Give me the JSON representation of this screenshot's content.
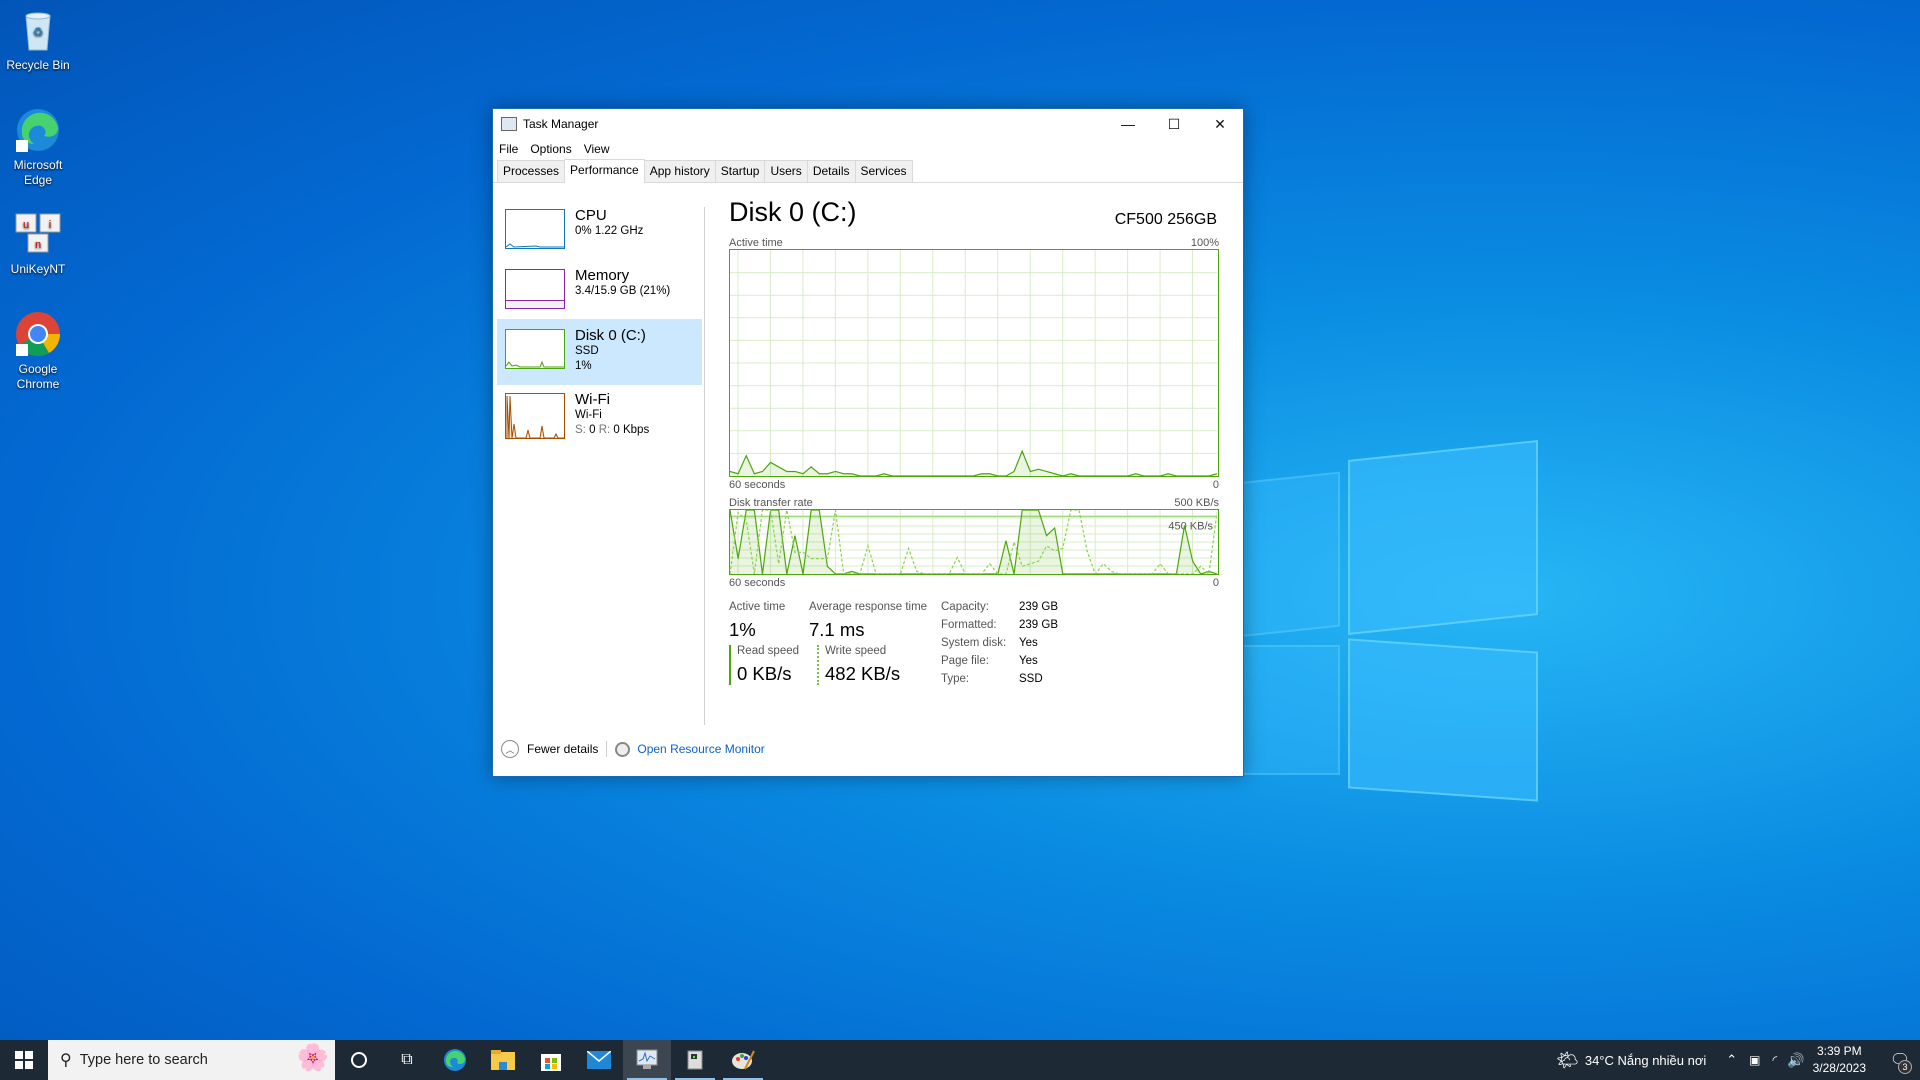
{
  "desktop": {
    "icons": [
      {
        "label": "Recycle Bin",
        "icon": "recycle-bin-icon"
      },
      {
        "label": "Microsoft Edge",
        "icon": "edge-icon"
      },
      {
        "label": "UniKeyNT",
        "icon": "unikey-icon"
      },
      {
        "label": "Google Chrome",
        "icon": "chrome-icon"
      }
    ]
  },
  "window": {
    "title": "Task Manager",
    "controls": {
      "minimize": "—",
      "maximize": "☐",
      "close": "✕"
    },
    "menu": [
      "File",
      "Options",
      "View"
    ],
    "tabs": [
      {
        "label": "Processes",
        "active": false
      },
      {
        "label": "Performance",
        "active": true
      },
      {
        "label": "App history",
        "active": false
      },
      {
        "label": "Startup",
        "active": false
      },
      {
        "label": "Users",
        "active": false
      },
      {
        "label": "Details",
        "active": false
      },
      {
        "label": "Services",
        "active": false
      }
    ]
  },
  "sidebar": {
    "items": [
      {
        "name": "CPU",
        "line1": "0% 1.22 GHz",
        "line2": "",
        "color": "#1179ba",
        "selected": false
      },
      {
        "name": "Memory",
        "line1": "3.4/15.9 GB (21%)",
        "line2": "",
        "color": "#8b27a8",
        "selected": false
      },
      {
        "name": "Disk 0 (C:)",
        "line1": "SSD",
        "line2": "1%",
        "color": "#4da60c",
        "selected": true
      },
      {
        "name": "Wi-Fi",
        "line1": "Wi-Fi",
        "line2_label_s": "S:",
        "line2_s": "0",
        "line2_label_r": "R:",
        "line2_r": "0 Kbps",
        "color": "#a74f01",
        "selected": false
      }
    ]
  },
  "main": {
    "title": "Disk 0 (C:)",
    "model": "CF500 256GB",
    "active_graph": {
      "label": "Active time",
      "max_label": "100%",
      "x_left": "60 seconds",
      "x_right": "0"
    },
    "transfer_graph": {
      "label": "Disk transfer rate",
      "max_label": "500 KB/s",
      "ref_label": "450 KB/s",
      "x_left": "60 seconds",
      "x_right": "0"
    },
    "stats": {
      "active_time_label": "Active time",
      "active_time": "1%",
      "avg_response_label": "Average response time",
      "avg_response": "7.1 ms",
      "read_label": "Read speed",
      "read": "0 KB/s",
      "write_label": "Write speed",
      "write": "482 KB/s"
    },
    "properties": [
      {
        "key": "Capacity:",
        "value": "239 GB"
      },
      {
        "key": "Formatted:",
        "value": "239 GB"
      },
      {
        "key": "System disk:",
        "value": "Yes"
      },
      {
        "key": "Page file:",
        "value": "Yes"
      },
      {
        "key": "Type:",
        "value": "SSD"
      }
    ]
  },
  "footer": {
    "fewer_details": "Fewer details",
    "resource_monitor": "Open Resource Monitor"
  },
  "chart_data": [
    {
      "type": "area",
      "title": "Active time",
      "xlabel": "60 seconds → 0",
      "ylabel": "%",
      "ylim": [
        0,
        100
      ],
      "x": [
        60,
        59,
        58,
        57,
        56,
        55,
        54,
        53,
        52,
        51,
        50,
        49,
        48,
        47,
        46,
        45,
        44,
        43,
        42,
        41,
        40,
        39,
        38,
        37,
        36,
        35,
        34,
        33,
        32,
        31,
        30,
        29,
        28,
        27,
        26,
        25,
        24,
        23,
        22,
        21,
        20,
        19,
        18,
        17,
        16,
        15,
        14,
        13,
        12,
        11,
        10,
        9,
        8,
        7,
        6,
        5,
        4,
        3,
        2,
        1,
        0
      ],
      "series": [
        {
          "name": "Active time",
          "values": [
            2,
            1,
            9,
            1,
            2,
            6,
            4,
            2,
            2,
            1,
            4,
            1,
            1,
            2,
            1,
            1,
            0,
            0,
            0,
            1,
            0,
            0,
            0,
            0,
            0,
            0,
            0,
            0,
            0,
            0,
            0,
            1,
            1,
            0,
            0,
            2,
            11,
            2,
            3,
            2,
            1,
            0,
            1,
            0,
            0,
            0,
            0,
            0,
            0,
            0,
            1,
            0,
            0,
            0,
            1,
            0,
            0,
            0,
            0,
            0,
            1
          ]
        }
      ]
    },
    {
      "type": "line",
      "title": "Disk transfer rate",
      "ylabel": "KB/s",
      "ylim": [
        0,
        500
      ],
      "reference_line": 450,
      "x": [
        60,
        59,
        58,
        57,
        56,
        55,
        54,
        53,
        52,
        51,
        50,
        49,
        48,
        47,
        46,
        45,
        44,
        43,
        42,
        41,
        40,
        39,
        38,
        37,
        36,
        35,
        34,
        33,
        32,
        31,
        30,
        29,
        28,
        27,
        26,
        25,
        24,
        23,
        22,
        21,
        20,
        19,
        18,
        17,
        16,
        15,
        14,
        13,
        12,
        11,
        10,
        9,
        8,
        7,
        6,
        5,
        4,
        3,
        2,
        1,
        0
      ],
      "series": [
        {
          "name": "Read speed",
          "style": "solid",
          "values": [
            500,
            120,
            500,
            500,
            0,
            500,
            500,
            0,
            300,
            0,
            500,
            500,
            60,
            0,
            0,
            20,
            0,
            0,
            0,
            0,
            0,
            0,
            0,
            0,
            0,
            0,
            0,
            0,
            0,
            0,
            0,
            0,
            0,
            0,
            260,
            0,
            500,
            500,
            500,
            300,
            360,
            0,
            0,
            0,
            0,
            0,
            0,
            0,
            0,
            0,
            0,
            0,
            0,
            0,
            0,
            0,
            380,
            100,
            0,
            20,
            0
          ]
        },
        {
          "name": "Write speed",
          "style": "dashed",
          "values": [
            0,
            480,
            420,
            0,
            500,
            500,
            80,
            500,
            170,
            170,
            120,
            120,
            120,
            500,
            0,
            0,
            0,
            220,
            0,
            0,
            0,
            0,
            200,
            20,
            0,
            0,
            0,
            0,
            130,
            0,
            0,
            0,
            80,
            0,
            0,
            250,
            60,
            80,
            100,
            220,
            180,
            200,
            500,
            500,
            180,
            0,
            80,
            20,
            0,
            0,
            0,
            0,
            0,
            80,
            0,
            0,
            0,
            0,
            60,
            0,
            480
          ]
        }
      ]
    }
  ],
  "taskbar": {
    "search_placeholder": "Type here to search",
    "apps": [
      "cortana-icon",
      "task-view-icon",
      "edge-icon",
      "file-explorer-icon",
      "store-icon",
      "mail-icon",
      "task-manager-icon",
      "resource-monitor-icon",
      "paint-icon"
    ],
    "weather": "34°C  Nắng nhiều nơi",
    "time": "3:39 PM",
    "date": "3/28/2023",
    "notification_count": "3"
  }
}
